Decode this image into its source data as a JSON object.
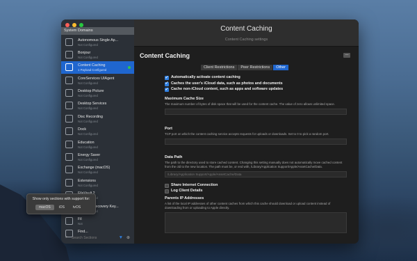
{
  "window": {
    "title": "Content Caching",
    "subtitle": "Content Caching settings"
  },
  "sidebar": {
    "header": "System Domains",
    "items": [
      {
        "name": "Autonomous Single Ap...",
        "status": "Not Configured",
        "icon": "lock-app-icon"
      },
      {
        "name": "Bonjour",
        "status": "Not Configured",
        "icon": "bonjour-icon"
      },
      {
        "name": "Content Caching",
        "status": "1 Payload Configured",
        "icon": "content-caching-icon",
        "selected": true
      },
      {
        "name": "CoreServices UIAgent",
        "status": "Not Configured",
        "icon": "core-services-icon"
      },
      {
        "name": "Desktop Picture",
        "status": "Not Configured",
        "icon": "desktop-picture-icon"
      },
      {
        "name": "Desktop Services",
        "status": "Not Configured",
        "icon": "desktop-services-icon"
      },
      {
        "name": "Disc Recording",
        "status": "Not Configured",
        "icon": "disc-icon"
      },
      {
        "name": "Dock",
        "status": "Not Configured",
        "icon": "dock-icon"
      },
      {
        "name": "Education",
        "status": "Not Configured",
        "icon": "education-icon"
      },
      {
        "name": "Energy Saver",
        "status": "Not Configured",
        "icon": "energy-saver-icon"
      },
      {
        "name": "Exchange (macOS)",
        "status": "Not Configured",
        "icon": "exchange-icon"
      },
      {
        "name": "Extensions",
        "status": "Not Configured",
        "icon": "extensions-icon"
      },
      {
        "name": "FileVault 2",
        "status": "Not Configured",
        "icon": "filevault-icon"
      },
      {
        "name": "FileVault Recovery Key...",
        "status": "Not Configured",
        "icon": "recovery-key-icon"
      },
      {
        "name": "Fil",
        "status": "Not",
        "icon": "file-icon"
      },
      {
        "name": "Find...",
        "status": "",
        "icon": "find-icon"
      }
    ],
    "search_placeholder": "Search Sections"
  },
  "popover": {
    "title": "Show only sections with support for:",
    "options": [
      "macOS",
      "iOS",
      "tvOS"
    ],
    "selected": "macOS"
  },
  "content": {
    "title": "Content Caching",
    "collapse_label": "—",
    "tabs": [
      "Client Restrictions",
      "Peer Restrictions",
      "Other"
    ],
    "active_tab": "Other",
    "checkboxes": [
      {
        "label": "Automatically activate content caching",
        "checked": true
      },
      {
        "label": "Caches the user's iCloud data, such as photos and documents",
        "checked": true
      },
      {
        "label": "Cache non-iCloud content, such as apps and software updates",
        "checked": true
      }
    ],
    "max_cache": {
      "title": "Maximum Cache Size",
      "desc": "The maximum number of bytes of disk space that will be used for the content cache. The value of zero allows unlimited space.",
      "value": ""
    },
    "port": {
      "title": "Port",
      "desc": "TCP port on which the content caching service accepts requests for uploads or downloads. Set to 0 to pick a random port.",
      "value": ""
    },
    "data_path": {
      "title": "Data Path",
      "desc": "The path to the directory used to store cached content. Changing this setting manually does not automatically move cached content from the old to the new location. The path must be, or end with, /Library/Application Support/Apple/AssetCache/Data.",
      "placeholder": "/Library/Application Support/Apple/AssetCache/Data"
    },
    "share_internet": {
      "label": "Share Internet Connection",
      "checked": false
    },
    "log_client": {
      "label": "Log Client Details",
      "checked": false
    },
    "parents": {
      "title": "Parents IP Addresses",
      "desc": "A list of the local IP addresses of other content caches from which this cache should download or upload content instead of downloading from or uploading to Apple directly."
    }
  },
  "colors": {
    "accent": "#1f66cf",
    "status_dot": "#33c24d"
  }
}
